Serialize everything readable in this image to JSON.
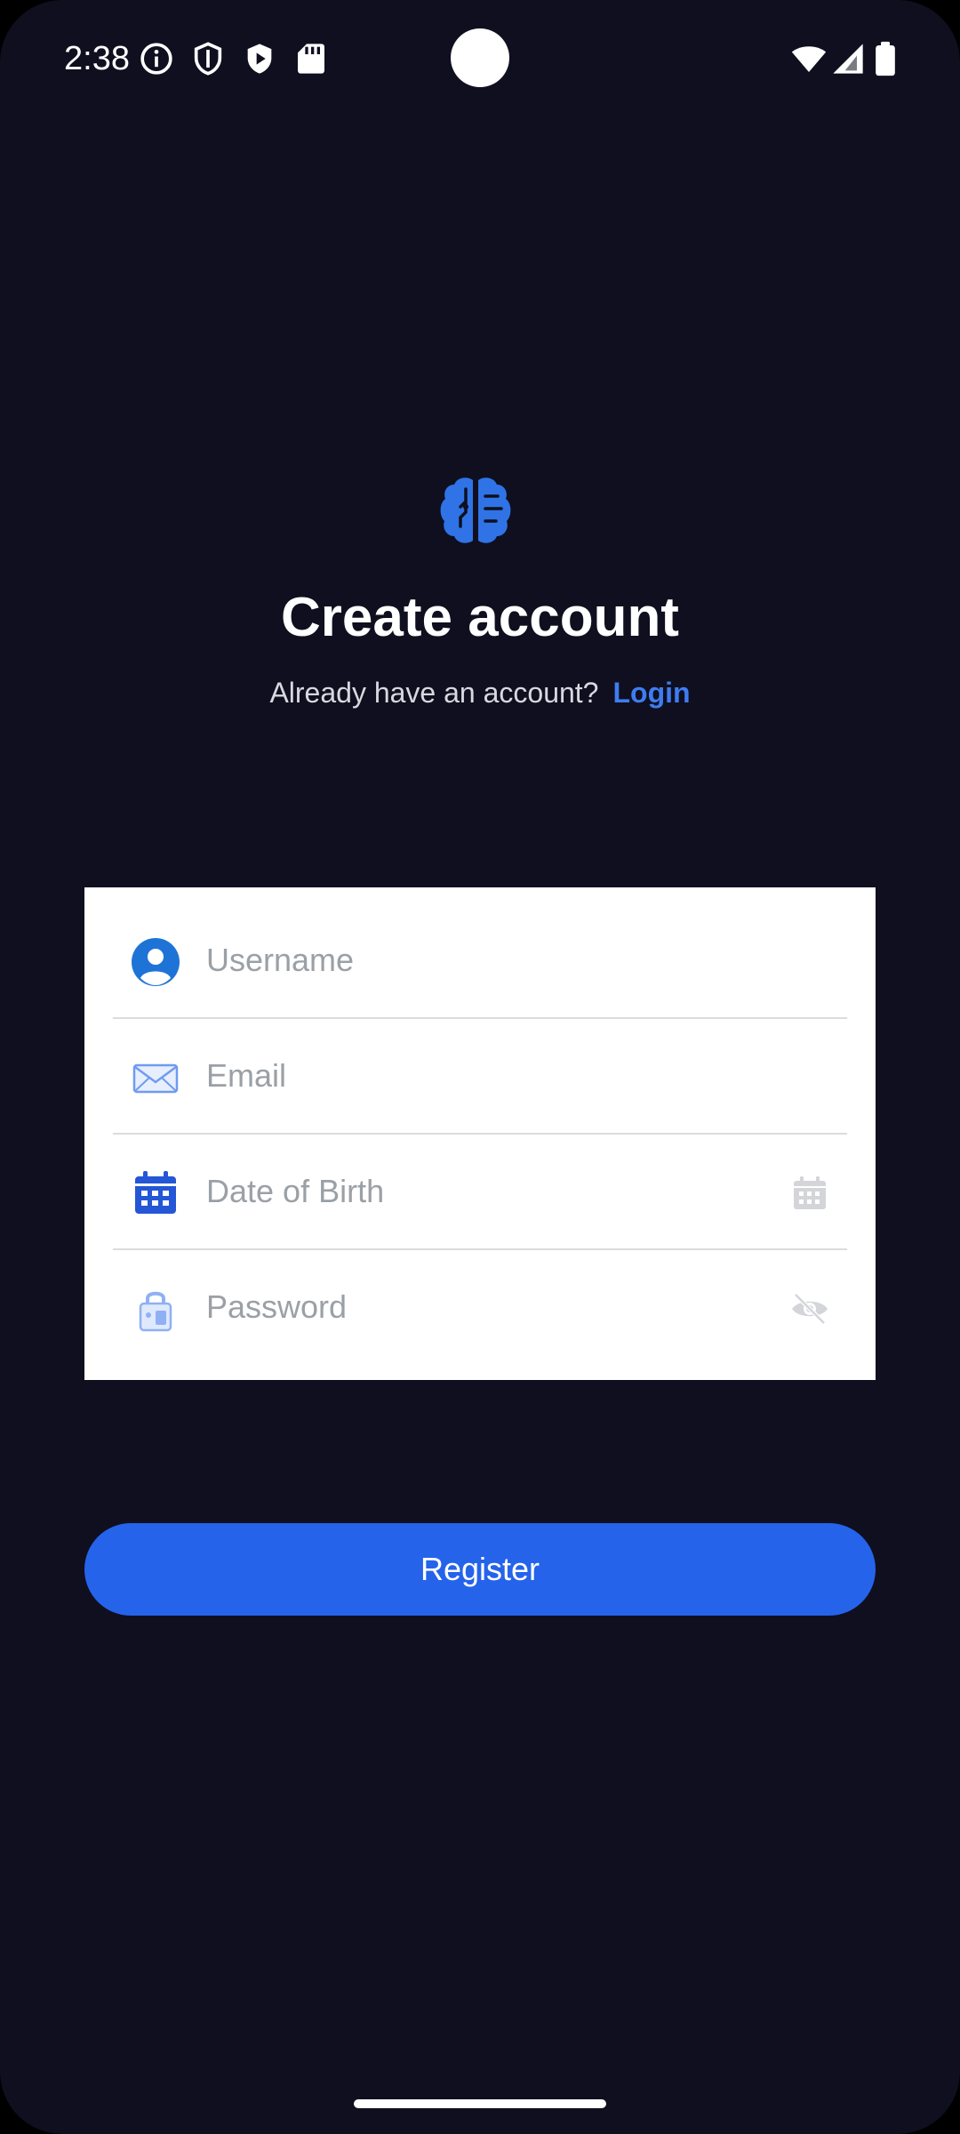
{
  "status_bar": {
    "time": "2:38",
    "left_icons": [
      "info-icon",
      "shield-icon",
      "play-shield-icon",
      "sd-card-icon"
    ],
    "right_icons": [
      "wifi-icon",
      "signal-icon",
      "battery-icon"
    ]
  },
  "header": {
    "logo_icon": "brain-icon",
    "title": "Create account",
    "login_prompt": "Already have an account?",
    "login_link": "Login"
  },
  "form": {
    "fields": [
      {
        "icon": "user-icon",
        "placeholder": "Username",
        "value": ""
      },
      {
        "icon": "mail-icon",
        "placeholder": "Email",
        "value": ""
      },
      {
        "icon": "calendar-icon",
        "placeholder": "Date of Birth",
        "value": "",
        "trailing_icon": "calendar-picker-icon"
      },
      {
        "icon": "lock-icon",
        "placeholder": "Password",
        "value": "",
        "trailing_icon": "eye-off-icon"
      }
    ]
  },
  "register_label": "Register",
  "colors": {
    "background": "#0f0f1f",
    "accent": "#2563eb",
    "link": "#3f7cf0",
    "card": "#ffffff",
    "placeholder": "#9aa0a6"
  }
}
